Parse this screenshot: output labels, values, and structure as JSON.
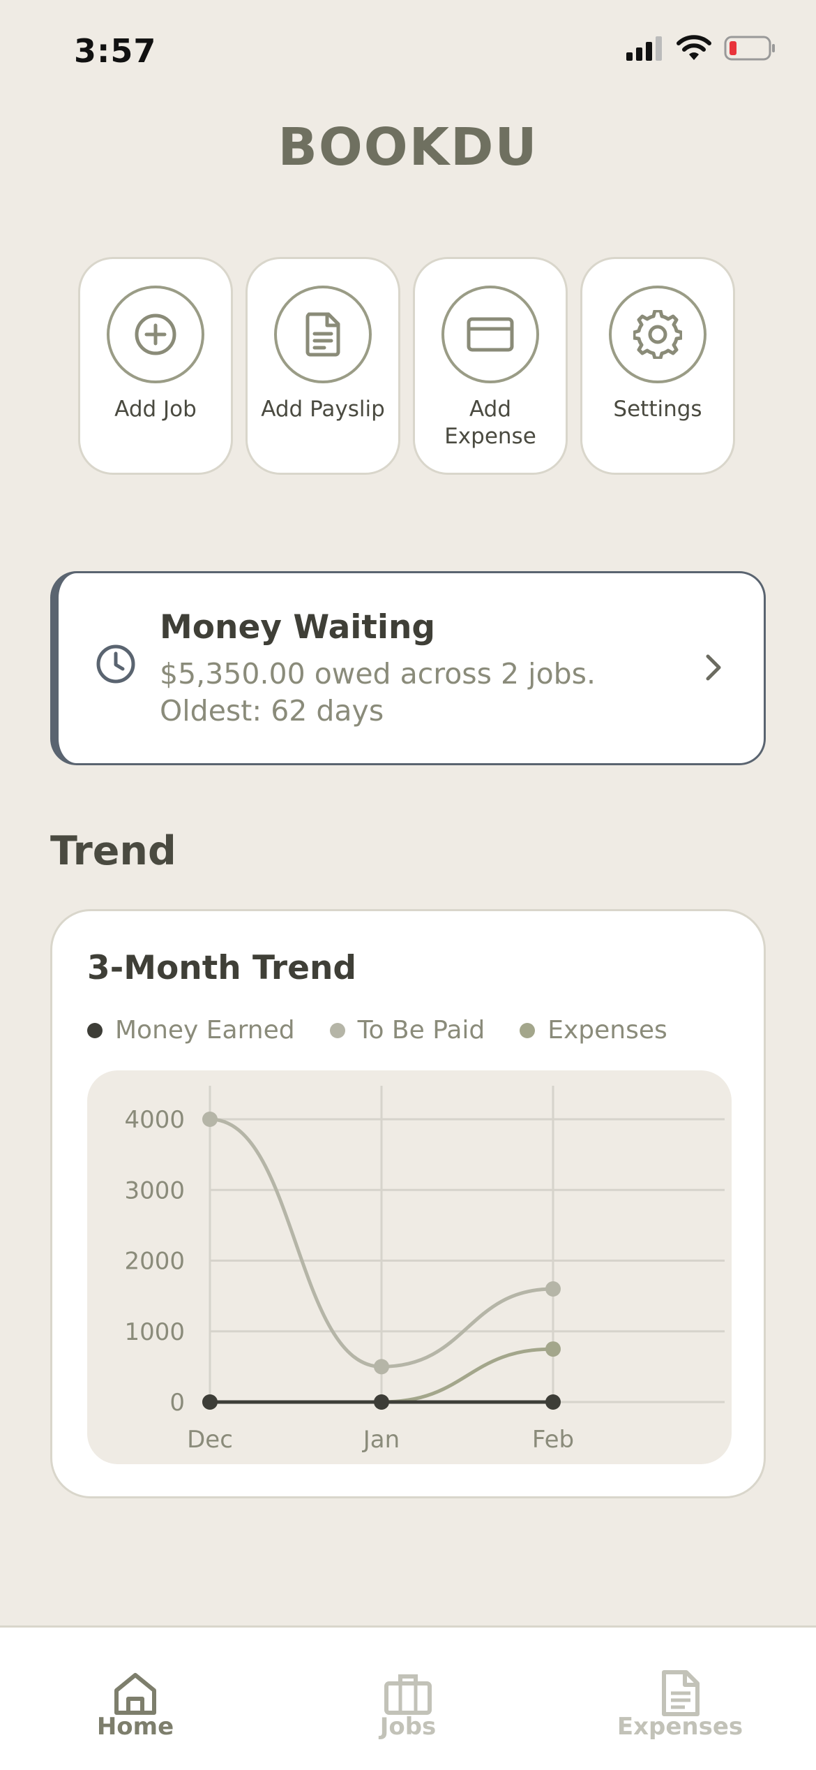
{
  "status_bar": {
    "time": "3:57"
  },
  "app": {
    "title": "BOOKDU"
  },
  "quick_actions": [
    {
      "label": "Add Job",
      "icon": "plus-circle-icon"
    },
    {
      "label": "Add Payslip",
      "icon": "document-icon"
    },
    {
      "label": "Add Expense",
      "icon": "credit-card-icon"
    },
    {
      "label": "Settings",
      "icon": "gear-icon"
    }
  ],
  "money_waiting": {
    "title": "Money Waiting",
    "line1": "$5,350.00 owed across 2 jobs.",
    "line2": "Oldest: 62 days"
  },
  "trend_section": {
    "title": "Trend"
  },
  "chart_data": {
    "type": "line",
    "title": "3-Month Trend",
    "x": [
      "Dec",
      "Jan",
      "Feb"
    ],
    "yticks": [
      0,
      1000,
      2000,
      3000,
      4000
    ],
    "ylim": [
      0,
      4000
    ],
    "series": [
      {
        "name": "Money Earned",
        "values": [
          0,
          0,
          0
        ],
        "color": "#3d3d37"
      },
      {
        "name": "To Be Paid",
        "values": [
          4000,
          500,
          1600
        ],
        "color": "#b5b5a7"
      },
      {
        "name": "Expenses",
        "values": [
          0,
          0,
          750
        ],
        "color": "#a3a68b"
      }
    ],
    "grid": true
  },
  "bottom_nav": [
    {
      "label": "Home",
      "icon": "home-icon",
      "active": true
    },
    {
      "label": "Jobs",
      "icon": "briefcase-icon",
      "active": false
    },
    {
      "label": "Expenses",
      "icon": "receipt-icon",
      "active": false
    }
  ],
  "colors": {
    "background": "#efebe4",
    "accent": "#9a9c86",
    "card_border": "#5a6470"
  }
}
